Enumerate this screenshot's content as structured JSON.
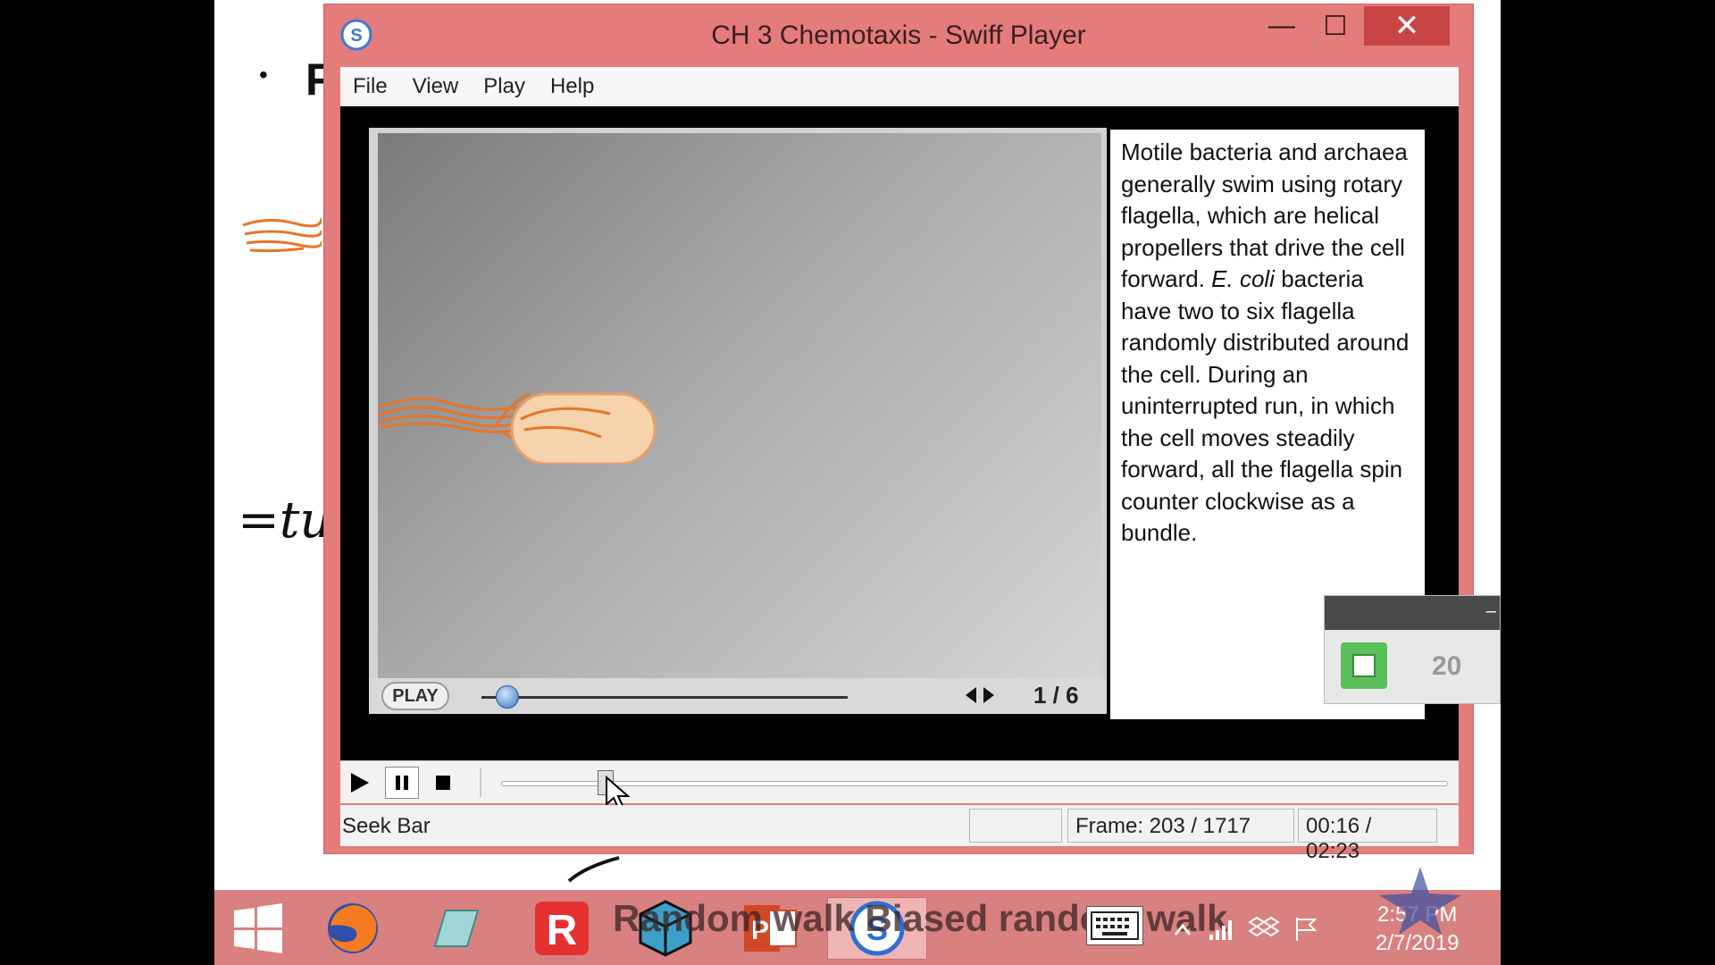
{
  "slide": {
    "bullet": "•",
    "partial_letter": "F",
    "handwriting": "=tu"
  },
  "window": {
    "title": "CH 3 Chemotaxis - Swiff Player",
    "minimize": "—",
    "maximize": "☐",
    "close": "✕"
  },
  "menu": {
    "items": [
      "File",
      "View",
      "Play",
      "Help"
    ]
  },
  "animation": {
    "play_label": "PLAY",
    "page": "1 / 6",
    "progress": 0.07,
    "caption_parts": [
      "Motile bacteria and archaea generally swim using rotary flagella, which are helical propellers that drive the cell forward. ",
      "E. coli",
      " bacteria have two to six flagella randomly distributed around the cell. During an uninterrupted run, in which the cell moves steadily forward, all the flagella spin counter clockwise as a bundle."
    ]
  },
  "player_controls": {
    "seek_progress": 0.11
  },
  "status": {
    "label": "Seek Bar",
    "frame": "Frame: 203 / 1717",
    "time": "00:16 / 02:23"
  },
  "widget": {
    "number": "20"
  },
  "taskbar": {
    "overlay_text": "Random walk  Biased random walk",
    "clock_time": "2:57 PM",
    "clock_date": "2/7/2019"
  },
  "colors": {
    "window_frame": "#e47c7c",
    "taskbar": "#d98080",
    "close_button": "#c94545"
  }
}
